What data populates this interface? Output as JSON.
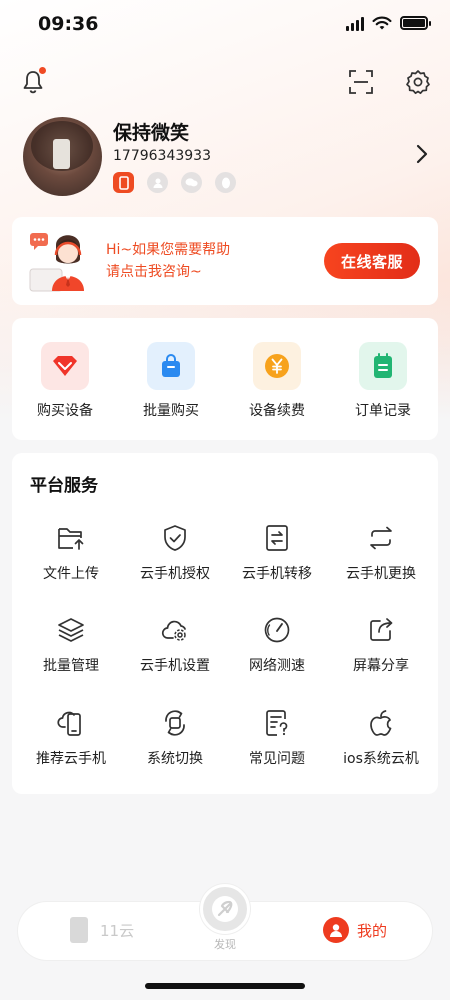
{
  "status_bar": {
    "time": "09:36"
  },
  "profile": {
    "name": "保持微笑",
    "phone": "17796343933",
    "badges": [
      "phone-icon",
      "user-icon",
      "chat-icon",
      "penguin-icon"
    ]
  },
  "help": {
    "line1": "Hi~如果您需要帮助",
    "line2": "请点击我咨询~",
    "button": "在线客服"
  },
  "quick_actions": [
    {
      "label": "购买设备",
      "icon": "diamond-icon",
      "color": "#f0352a"
    },
    {
      "label": "批量购买",
      "icon": "shopping-bag-icon",
      "color": "#2b8af0"
    },
    {
      "label": "设备续费",
      "icon": "yen-icon",
      "color": "#f7a21c"
    },
    {
      "label": "订单记录",
      "icon": "notepad-icon",
      "color": "#22b573"
    }
  ],
  "services": {
    "title": "平台服务",
    "items": [
      {
        "label": "文件上传",
        "icon": "folder-upload-icon"
      },
      {
        "label": "云手机授权",
        "icon": "shield-check-icon"
      },
      {
        "label": "云手机转移",
        "icon": "transfer-icon"
      },
      {
        "label": "云手机更换",
        "icon": "swap-icon"
      },
      {
        "label": "批量管理",
        "icon": "layers-icon"
      },
      {
        "label": "云手机设置",
        "icon": "cloud-gear-icon"
      },
      {
        "label": "网络测速",
        "icon": "speedometer-icon"
      },
      {
        "label": "屏幕分享",
        "icon": "share-icon"
      },
      {
        "label": "推荐云手机",
        "icon": "cloud-phone-icon"
      },
      {
        "label": "系统切换",
        "icon": "switch-icon"
      },
      {
        "label": "常见问题",
        "icon": "faq-icon"
      },
      {
        "label": "ios系统云机",
        "icon": "apple-icon"
      }
    ]
  },
  "bottom_nav": {
    "left": "11云",
    "center": "发现",
    "right": "我的"
  },
  "colors": {
    "accent": "#ee4b22"
  }
}
